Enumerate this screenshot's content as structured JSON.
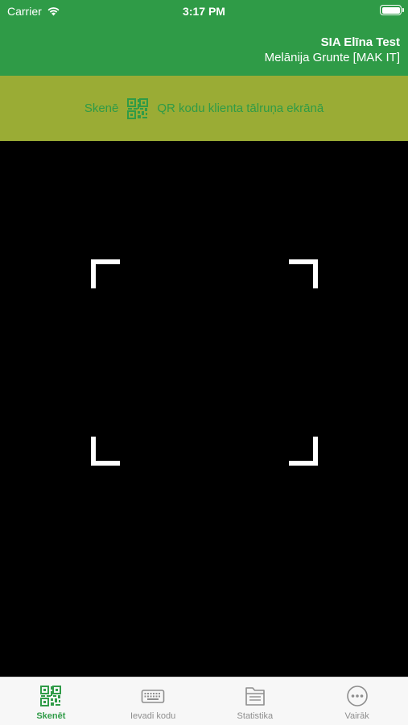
{
  "status_bar": {
    "carrier": "Carrier",
    "time": "3:17 PM"
  },
  "header": {
    "company": "SIA Elīna Test",
    "user": "Melānija Grunte [MAK IT]"
  },
  "banner": {
    "prefix": "Skenē",
    "suffix": "QR kodu klienta tālruņa ekrānā",
    "icon": "qr-code-icon"
  },
  "tabs": [
    {
      "label": "Skenēt",
      "icon": "qr-code-icon",
      "active": true
    },
    {
      "label": "Ievadi kodu",
      "icon": "keyboard-icon",
      "active": false
    },
    {
      "label": "Statistika",
      "icon": "folder-icon",
      "active": false
    },
    {
      "label": "Vairāk",
      "icon": "more-icon",
      "active": false
    }
  ],
  "colors": {
    "primary_green": "#2f9b47",
    "banner_olive": "#9aac35",
    "tab_gray": "#8e8e8e"
  }
}
